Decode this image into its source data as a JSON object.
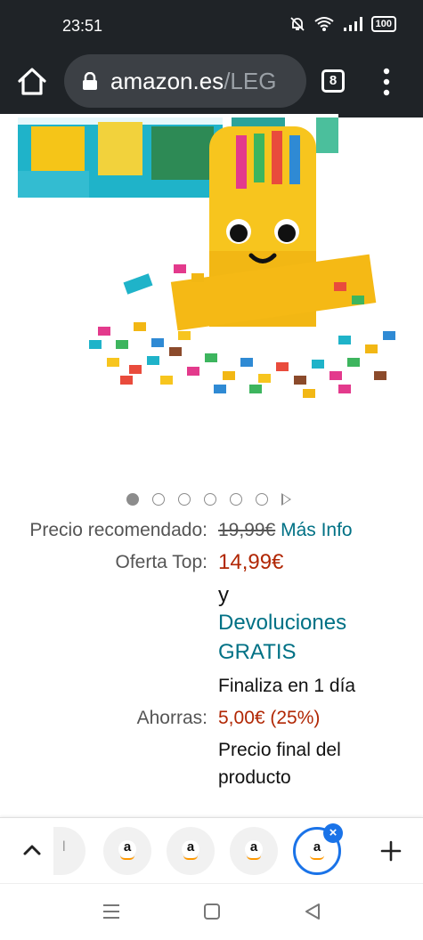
{
  "status_bar": {
    "time": "23:51",
    "battery": "100",
    "icons": [
      "bell-off-icon",
      "wifi-icon",
      "signal-icon",
      "battery-icon"
    ]
  },
  "browser": {
    "url_domain": "amazon.es",
    "url_path": "/LEG",
    "tab_count": "8",
    "page_load_progress": 0.8
  },
  "gallery": {
    "image_alt": "LEGO DOTS banana pen holder",
    "total_images": 6,
    "active_index": 0
  },
  "pricing": {
    "recommended_label": "Precio recomendado:",
    "recommended_price": "19,99€",
    "more_info_link": "Más Info",
    "offer_label": "Oferta Top:",
    "offer_price": "14,99€",
    "and_text": "y",
    "returns_line1": "Devoluciones",
    "returns_line2": "GRATIS",
    "ends_text": "Finaliza en 1 día",
    "savings_label": "Ahorras:",
    "savings_value": "5,00€ (25%)",
    "final_line1": "Precio final del",
    "final_line2": "producto"
  },
  "tab_strip": {
    "collapse_icon": "chevron-up-icon",
    "favicon_letter": "a",
    "partial_tab_letter": "l",
    "new_tab_icon": "plus-icon",
    "close_icon": "close-icon"
  },
  "nav_bar": {
    "icons": [
      "menu-icon",
      "home-square-icon",
      "back-triangle-icon"
    ]
  },
  "colors": {
    "bar_bg": "#1f2327",
    "price_red": "#b12704",
    "link_teal": "#007185",
    "selected_blue": "#1a73e8"
  }
}
